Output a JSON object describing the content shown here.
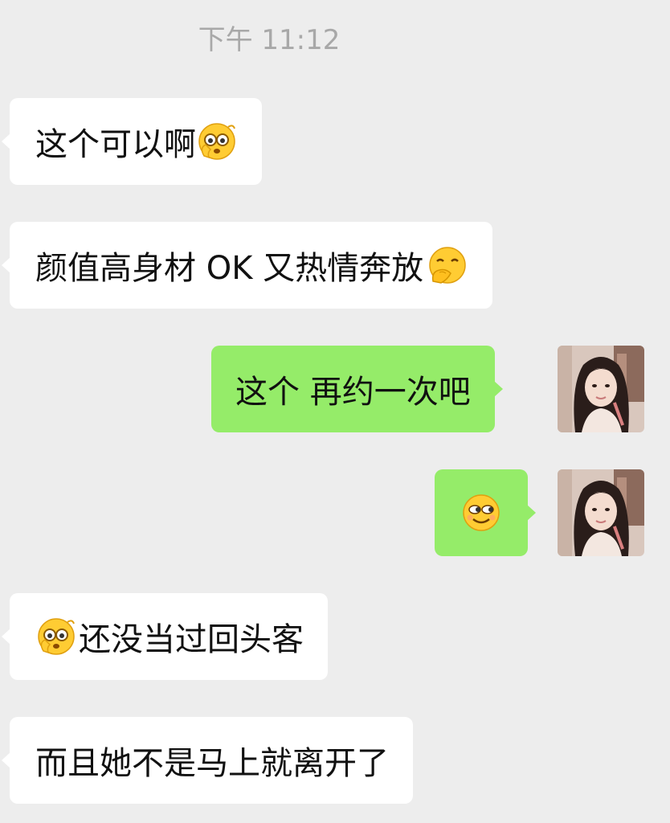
{
  "timestamp": "下午 11:12",
  "messages": [
    {
      "side": "received",
      "text": "这个可以啊",
      "emoji": "monocle-thinking-face-icon"
    },
    {
      "side": "received",
      "text": "颜值高身材 OK 又热情奔放",
      "emoji": "hand-over-mouth-face-icon"
    },
    {
      "side": "sent",
      "text": "这个 再约一次吧",
      "avatar": "user-avatar"
    },
    {
      "side": "sent",
      "text": "",
      "emoji": "sly-smile-face-icon",
      "avatar": "user-avatar"
    },
    {
      "side": "received",
      "text": "还没当过回头客",
      "emoji": "monocle-thinking-face-icon"
    },
    {
      "side": "received",
      "text": "而且她不是马上就离开了"
    }
  ],
  "colors": {
    "background": "#ededed",
    "received_bubble": "#ffffff",
    "sent_bubble": "#95ec69",
    "timestamp_text": "#a8a8a8"
  }
}
